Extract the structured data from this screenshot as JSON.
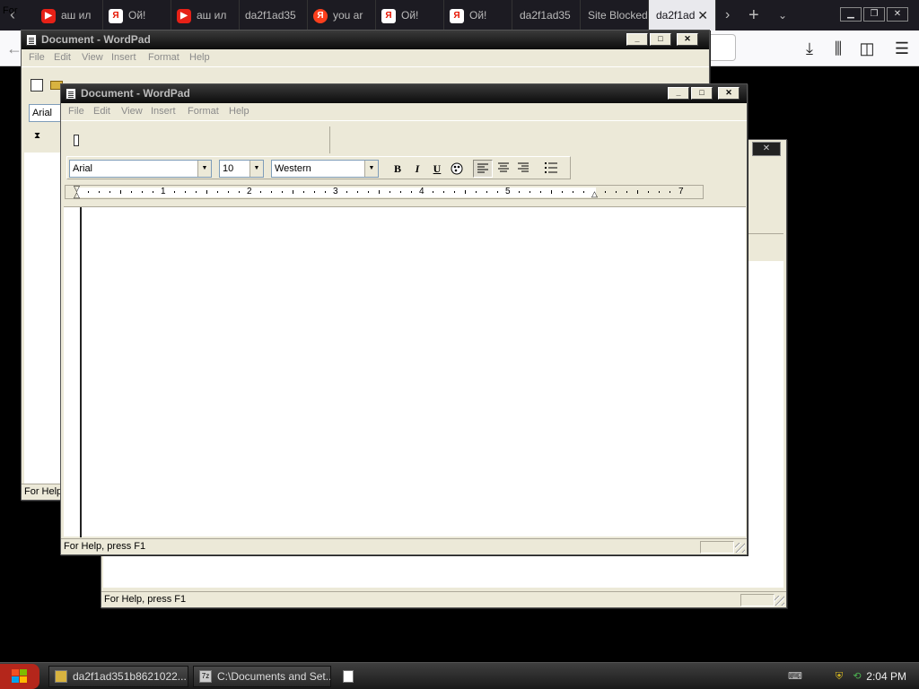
{
  "browser": {
    "tabs": [
      {
        "label": "аш ил",
        "favicon": "youtube-icon"
      },
      {
        "label": "Ой!",
        "favicon": "yandex-icon"
      },
      {
        "label": "аш ил",
        "favicon": "youtube-icon"
      },
      {
        "label": "da2f1ad35",
        "favicon": ""
      },
      {
        "label": "you ar",
        "favicon": "yandex-browser-icon"
      },
      {
        "label": "Ой!",
        "favicon": "yandex-icon"
      },
      {
        "label": "Ой!",
        "favicon": "yandex-icon"
      },
      {
        "label": "da2f1ad35",
        "favicon": ""
      },
      {
        "label": "Site Blocked",
        "favicon": ""
      },
      {
        "label": "da2f1ad",
        "favicon": "",
        "active": true
      }
    ]
  },
  "back_window": {
    "title": "Document - WordPad",
    "menu": [
      "File",
      "Edit",
      "View",
      "Insert",
      "Format",
      "Help"
    ],
    "font": "Arial",
    "status": "For Help",
    "status2": "For"
  },
  "back_window_2": {
    "status": "For Help, press F1"
  },
  "wordpad": {
    "title": "Document - WordPad",
    "menu": [
      "File",
      "Edit",
      "View",
      "Insert",
      "Format",
      "Help"
    ],
    "font_name": "Arial",
    "font_size": "10",
    "script": "Western",
    "format_buttons": {
      "bold": "B",
      "italic": "I",
      "underline": "U"
    },
    "ruler_numbers": [
      "1",
      "2",
      "3",
      "4",
      "5",
      "7"
    ],
    "status": "For Help, press F1"
  },
  "taskbar": {
    "items": [
      {
        "label": "da2f1ad351b8621022...",
        "icon": "folder-icon"
      },
      {
        "label": "C:\\Documents and Set...",
        "icon": "7zip-icon"
      }
    ],
    "clock": "2:04 PM"
  },
  "colors": {
    "browser_tabbar": "#1c1b22",
    "start_button": "#b4261b",
    "window_face": "#ece9d8"
  }
}
